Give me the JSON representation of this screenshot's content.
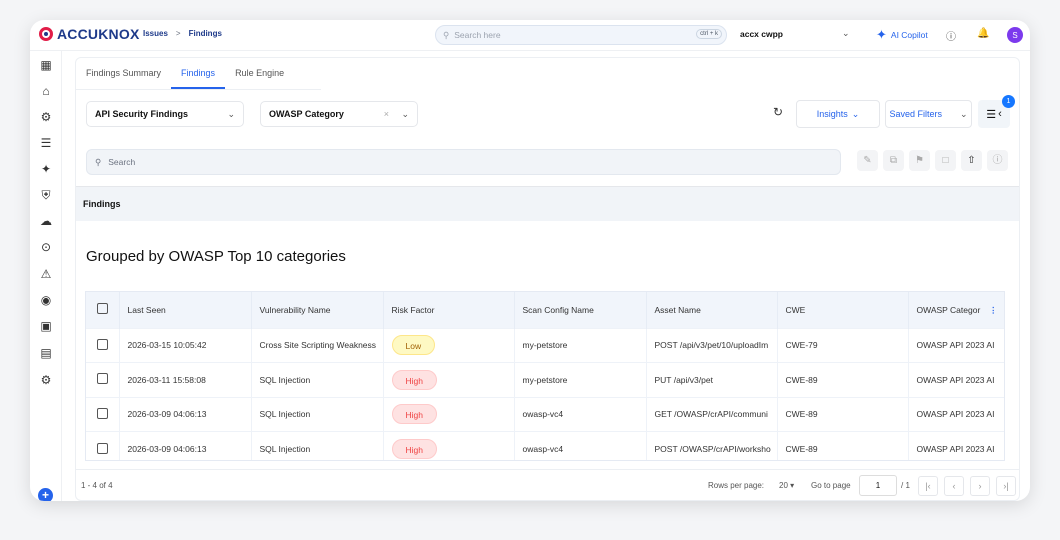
{
  "brand": {
    "name": "ACCUKNOX"
  },
  "breadcrumb": [
    "Issues",
    "Findings"
  ],
  "topbar": {
    "search_placeholder": "Search here",
    "shortcut": "ctrl + k",
    "workspace": "accx cwpp",
    "copilot": "AI Copilot",
    "avatar_initial": "S"
  },
  "sidebar": {
    "icons": [
      "dashboard-icon",
      "inventory-icon",
      "bug-icon",
      "layers-icon",
      "sparkles-icon",
      "shield-icon",
      "cloud-icon",
      "signal-icon",
      "alert-icon",
      "fingerprint-icon",
      "settings-box-icon",
      "report-icon",
      "gear-icon"
    ]
  },
  "tabs": [
    {
      "label": "Findings Summary"
    },
    {
      "label": "Findings",
      "active": true
    },
    {
      "label": "Rule Engine"
    }
  ],
  "filters": {
    "finding_type": "API Security Findings",
    "group_by": "OWASP Category",
    "insights": "Insights",
    "saved_filters": "Saved Filters",
    "filter_count": "1"
  },
  "search": {
    "placeholder": "Search"
  },
  "section_title": "Findings",
  "grouped_title": "Grouped by OWASP Top 10 categories",
  "table": {
    "columns": [
      "Last Seen",
      "Vulnerability Name",
      "Risk Factor",
      "Scan Config Name",
      "Asset Name",
      "CWE",
      "OWASP Categor"
    ],
    "rows": [
      {
        "last_seen": "2026-03-15 10:05:42",
        "vuln": "Cross Site Scripting Weakness",
        "risk": "Low",
        "scan": "my-petstore",
        "asset": "POST /api/v3/pet/10/uploadIm",
        "cwe": "CWE-79",
        "owasp": "OWASP API 2023 AI"
      },
      {
        "last_seen": "2026-03-11 15:58:08",
        "vuln": "SQL Injection",
        "risk": "High",
        "scan": "my-petstore",
        "asset": "PUT /api/v3/pet",
        "cwe": "CWE-89",
        "owasp": "OWASP API 2023 AI"
      },
      {
        "last_seen": "2026-03-09 04:06:13",
        "vuln": "SQL Injection",
        "risk": "High",
        "scan": "owasp-vc4",
        "asset": "GET /OWASP/crAPI/communi",
        "cwe": "CWE-89",
        "owasp": "OWASP API 2023 AI"
      },
      {
        "last_seen": "2026-03-09 04:06:13",
        "vuln": "SQL Injection",
        "risk": "High",
        "scan": "owasp-vc4",
        "asset": "POST /OWASP/crAPI/worksho",
        "cwe": "CWE-89",
        "owasp": "OWASP API 2023 AI"
      }
    ]
  },
  "pagination": {
    "range": "1 - 4 of 4",
    "rows_label": "Rows per page:",
    "rows_value": "20",
    "goto_label": "Go to page",
    "page": "1",
    "total": "/ 1"
  }
}
